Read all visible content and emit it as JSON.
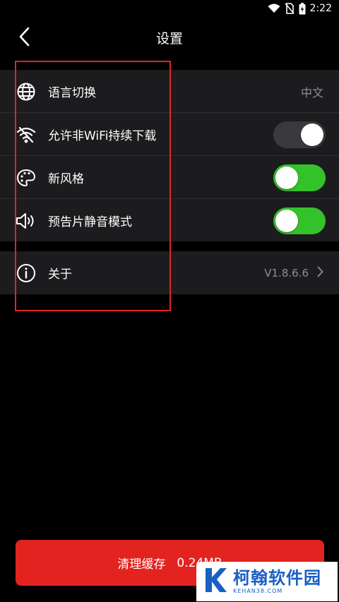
{
  "status_bar": {
    "time": "2:22",
    "icons": [
      "wifi-icon",
      "no-sim-icon",
      "battery-icon"
    ]
  },
  "header": {
    "title": "设置",
    "back_icon": "chevron-left-icon"
  },
  "settings": {
    "language": {
      "label": "语言切换",
      "value": "中文",
      "icon": "globe-icon"
    },
    "wifi_download": {
      "label": "允许非WiFi持续下载",
      "icon": "wifi-off-icon",
      "enabled": false
    },
    "new_style": {
      "label": "新风格",
      "icon": "palette-icon",
      "enabled": true
    },
    "trailer_mute": {
      "label": "预告片静音模式",
      "icon": "speaker-icon",
      "enabled": true
    },
    "about": {
      "label": "关于",
      "version": "V1.8.6.6",
      "icon": "info-icon"
    }
  },
  "clear_cache": {
    "label": "清理缓存",
    "size": "0.24MB"
  },
  "watermark": {
    "title": "柯翰软件园",
    "subtitle": "KEHAN38.COM"
  },
  "colors": {
    "background": "#000000",
    "group_bg": "#1c1c1e",
    "toggle_on": "#34c22b",
    "toggle_off": "#3a3a3c",
    "accent_red": "#e3231f",
    "watermark_blue": "#1a5fc4"
  }
}
